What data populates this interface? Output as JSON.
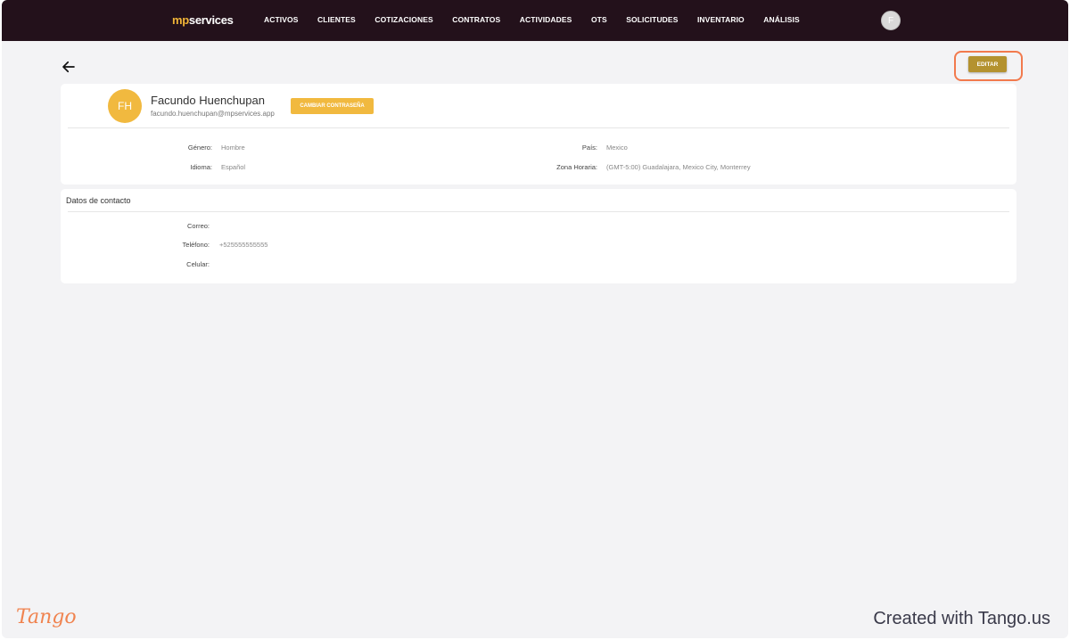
{
  "header": {
    "logo_mp": "mp",
    "logo_services": "services",
    "nav": [
      "ACTIVOS",
      "CLIENTES",
      "COTIZACIONES",
      "CONTRATOS",
      "ACTIVIDADES",
      "OTS",
      "SOLICITUDES",
      "INVENTARIO",
      "ANÁLISIS"
    ],
    "user_initial": "F"
  },
  "toolbar": {
    "edit_label": "EDITAR"
  },
  "profile": {
    "initials": "FH",
    "name": "Facundo Huenchupan",
    "email": "facundo.huenchupan@mpservices.app",
    "change_password_label": "CAMBIAR CONTRASEÑA",
    "fields": {
      "gender_label": "Género:",
      "gender_value": "Hombre",
      "language_label": "Idioma:",
      "language_value": "Español",
      "country_label": "País:",
      "country_value": "Mexico",
      "timezone_label": "Zona Horaria:",
      "timezone_value": "(GMT-5:00) Guadalajara, Mexico City, Monterrey"
    }
  },
  "contact": {
    "title": "Datos de contacto",
    "email_label": "Correo:",
    "email_value": "",
    "phone_label": "Teléfono:",
    "phone_value": "+525555555555",
    "mobile_label": "Celular:",
    "mobile_value": ""
  },
  "watermark": {
    "logo": "Tango",
    "footer": "Created with Tango.us"
  },
  "colors": {
    "topbar": "#23111b",
    "accent": "#f1b93f",
    "edit_button": "#b4922f",
    "highlight": "#f27a4d"
  }
}
